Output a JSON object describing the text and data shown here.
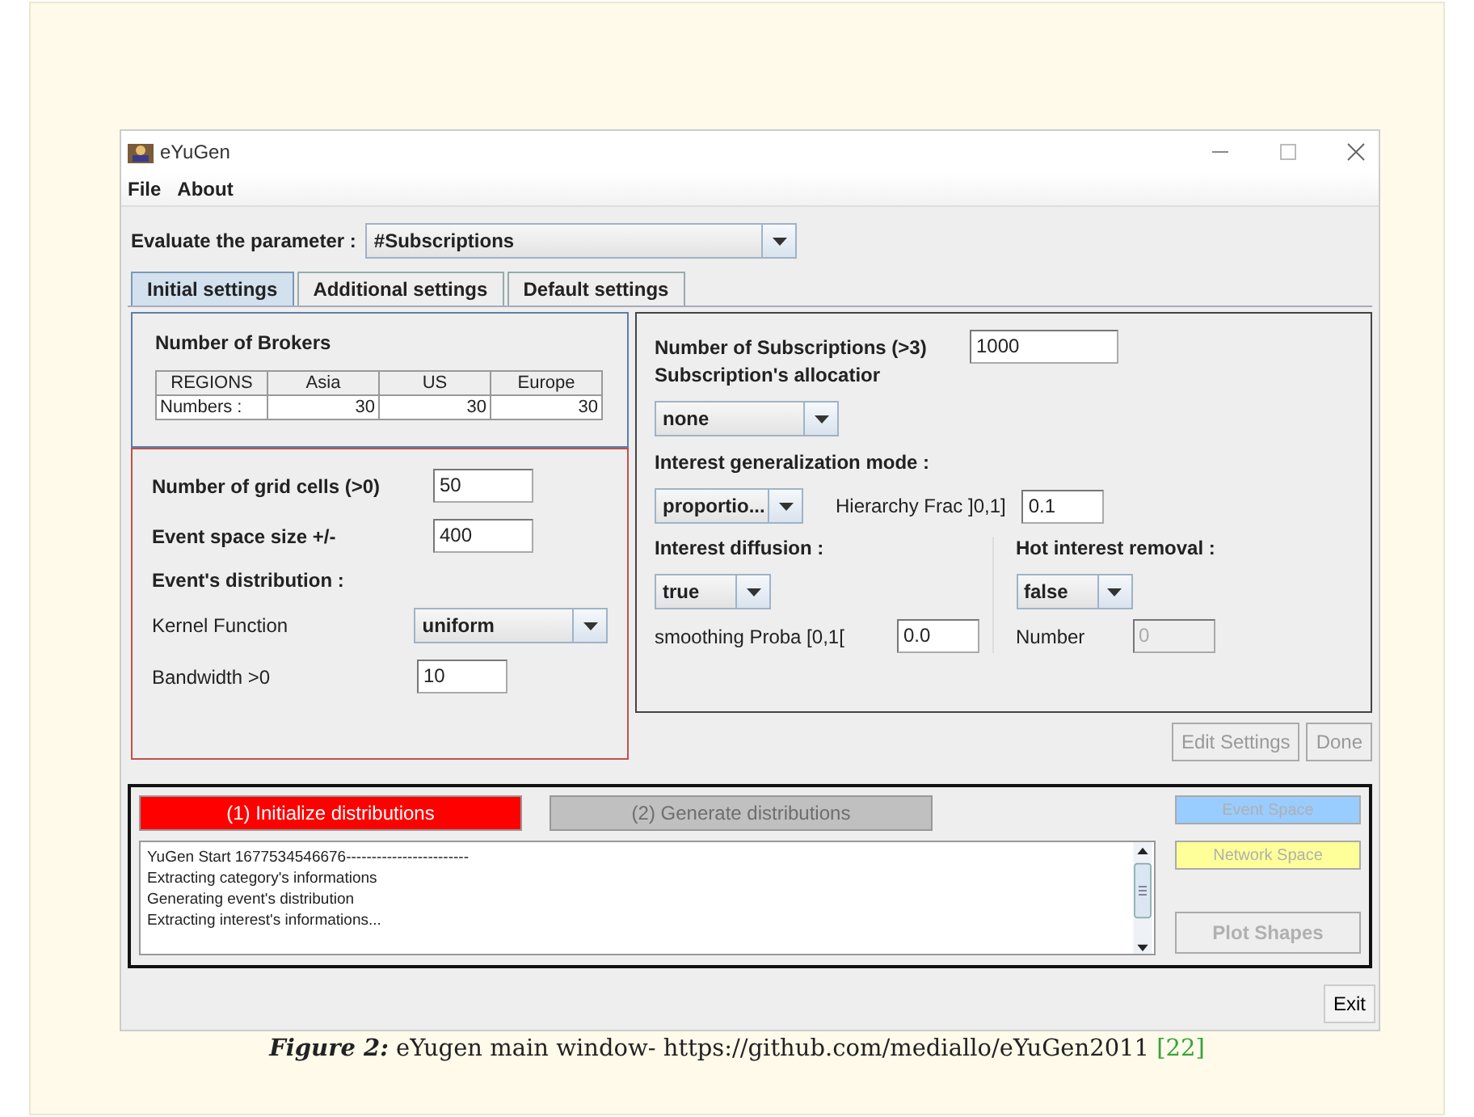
{
  "window": {
    "title": "eYuGen"
  },
  "menu": [
    "File",
    "About"
  ],
  "evaluate": {
    "label": "Evaluate the parameter :",
    "value": "#Subscriptions"
  },
  "tabs": [
    {
      "label": "Initial settings",
      "selected": true
    },
    {
      "label": "Additional settings",
      "selected": false
    },
    {
      "label": "Default settings",
      "selected": false
    }
  ],
  "brokers": {
    "title": "Number of Brokers",
    "header": [
      "REGIONS",
      "Asia",
      "US",
      "Europe"
    ],
    "row": [
      "Numbers :",
      "30",
      "30",
      "30"
    ]
  },
  "grid": {
    "fields": [
      {
        "label": "Number of grid cells (>0)",
        "value": "50"
      },
      {
        "label": "Event space size +/-",
        "value": "400"
      }
    ],
    "distribution_title": "Event's distribution :",
    "kernel": {
      "label": "Kernel Function",
      "value": "uniform"
    },
    "bandwidth": {
      "label": "Bandwidth >0",
      "value": "10"
    }
  },
  "subscriptions": {
    "count_label": "Number of Subscriptions (>3)",
    "count_value": "1000",
    "allocation_label": "Subscription's allocatior",
    "allocation_value": "none",
    "generalization_label": "Interest generalization mode :",
    "generalization_value": "proportio...",
    "hierarchy_label": "Hierarchy Frac ]0,1]",
    "hierarchy_value": "0.1",
    "diffusion_label": "Interest diffusion :",
    "diffusion_value": "true",
    "smoothing_label": "smoothing Proba [0,1[",
    "smoothing_value": "0.0",
    "removal_label": "Hot interest removal :",
    "removal_value": "false",
    "number_label": "Number",
    "number_value": "0",
    "number_disabled": true
  },
  "actions": [
    {
      "label": "Edit Settings",
      "disabled": true
    },
    {
      "label": "Done",
      "disabled": true
    }
  ],
  "run": [
    {
      "label": "(1) Initialize distributions",
      "disabled": false,
      "color": "#ff0000"
    },
    {
      "label": "(2) Generate distributions",
      "disabled": true,
      "color": "#c0c0c0"
    }
  ],
  "side_buttons": [
    {
      "label": "Event Space",
      "disabled": true,
      "color": "#99ccff"
    },
    {
      "label": "Network Space",
      "disabled": true,
      "color": "#ffff99"
    },
    {
      "label": "Plot Shapes",
      "disabled": true,
      "color": "#eeeeee"
    }
  ],
  "log": [
    "YuGen Start 1677534546676------------------------",
    "Extracting category's informations",
    "Generating event's distribution",
    "Extracting interest's informations..."
  ],
  "exit": "Exit",
  "caption": {
    "label": "Figure 2:",
    "text": "eYugen main window- https://github.com/mediallo/eYuGen2011",
    "ref": "[22]"
  }
}
